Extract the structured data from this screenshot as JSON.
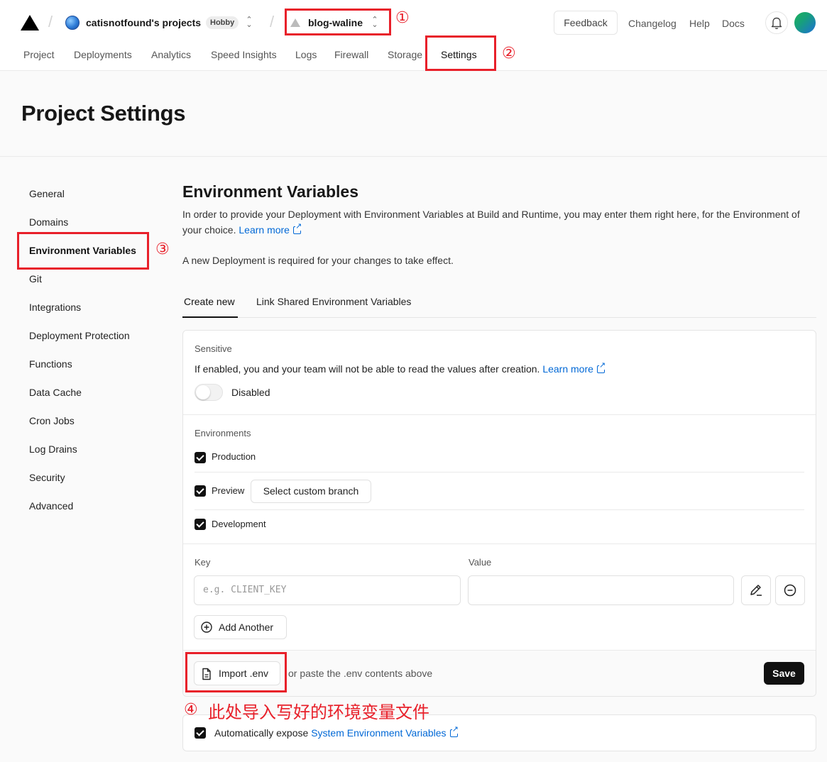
{
  "header": {
    "team_name": "catisnotfound's projects",
    "plan_badge": "Hobby",
    "project_name": "blog-waline",
    "feedback": "Feedback",
    "links": [
      "Changelog",
      "Help",
      "Docs"
    ]
  },
  "nav": {
    "tabs": [
      "Project",
      "Deployments",
      "Analytics",
      "Speed Insights",
      "Logs",
      "Firewall",
      "Storage",
      "Settings"
    ],
    "active": "Settings"
  },
  "page_title": "Project Settings",
  "sidebar": {
    "items": [
      "General",
      "Domains",
      "Environment Variables",
      "Git",
      "Integrations",
      "Deployment Protection",
      "Functions",
      "Data Cache",
      "Cron Jobs",
      "Log Drains",
      "Security",
      "Advanced"
    ],
    "active": "Environment Variables"
  },
  "env": {
    "heading": "Environment Variables",
    "desc_line": "In order to provide your Deployment with Environment Variables at Build and Runtime, you may enter them right here, for the Environment of your choice.",
    "learn_more": "Learn more",
    "note": "A new Deployment is required for your changes to take effect.",
    "tabs": [
      "Create new",
      "Link Shared Environment Variables"
    ],
    "sensitive_label": "Sensitive",
    "sensitive_desc": "If enabled, you and your team will not be able to read the values after creation.",
    "sensitive_state": "Disabled",
    "environments_label": "Environments",
    "production": "Production",
    "preview": "Preview",
    "select_branch": "Select custom branch",
    "development": "Development",
    "key_label": "Key",
    "value_label": "Value",
    "key_placeholder": "e.g. CLIENT_KEY",
    "add_another": "Add Another",
    "import_env": "Import .env",
    "paste_hint": "or paste the .env contents above",
    "save": "Save",
    "auto_expose_prefix": "Automatically expose",
    "auto_expose_link": "System Environment Variables"
  },
  "annotations": {
    "marks": [
      "①",
      "②",
      "③",
      "④"
    ],
    "step4_text": "此处导入写好的环境变量文件",
    "color": "#e8202a"
  },
  "colors": {
    "link": "#0068d6",
    "primary": "#111111"
  }
}
